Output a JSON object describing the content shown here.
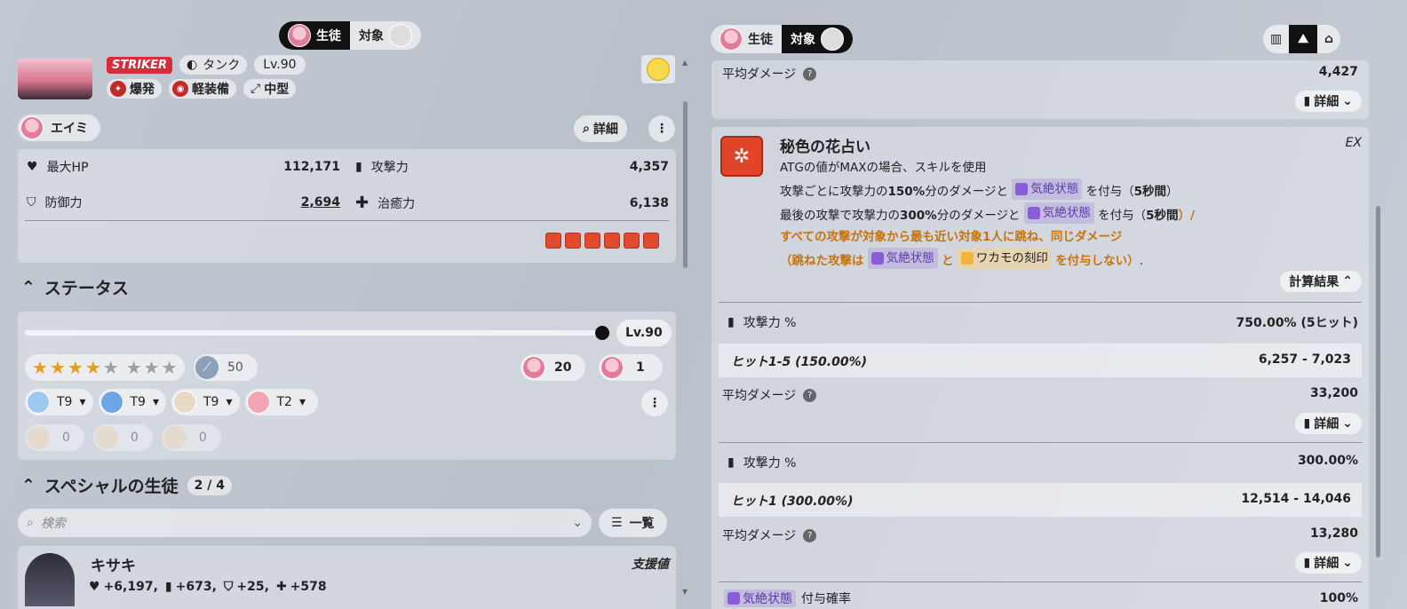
{
  "left_header": {
    "tab_student": "生徒",
    "tab_target": "対象"
  },
  "right_header": {
    "tab_student": "生徒",
    "tab_target": "対象"
  },
  "profile": {
    "class_badge": "STRIKER",
    "role": "タンク",
    "level": "Lv.90",
    "attack_type": "爆発",
    "armor_type": "軽装備",
    "position": "中型"
  },
  "student": {
    "name": "エイミ",
    "detail_label": "詳細"
  },
  "stats": [
    {
      "label": "最大HP",
      "value": "112,171",
      "icon": "heart-icon"
    },
    {
      "label": "攻撃力",
      "value": "4,357",
      "icon": "sword-icon"
    },
    {
      "label": "防御力",
      "value": "2,694",
      "icon": "shield-icon"
    },
    {
      "label": "治癒力",
      "value": "6,138",
      "icon": "cross-icon"
    }
  ],
  "status_section": {
    "title": "ステータス",
    "level": "Lv.90",
    "weapon_level": "50",
    "bond1": "20",
    "bond2": "1",
    "gear": [
      "T9",
      "T9",
      "T9",
      "T2"
    ],
    "items": [
      "0",
      "0",
      "0"
    ],
    "stars_filled": 4,
    "stars_total": 7
  },
  "special_section": {
    "title": "スペシャルの生徒",
    "count": "2 / 4",
    "search_placeholder": "検索",
    "list_label": "一覧"
  },
  "support_student": {
    "name": "キサキ",
    "tag": "支援値",
    "bonus_hp": "+6,197,",
    "bonus_atk": "+673,",
    "bonus_def": "+25,",
    "bonus_heal": "+578"
  },
  "right_top": {
    "avg_label": "平均ダメージ",
    "avg_value": "4,427",
    "detail_label": "詳細"
  },
  "skill": {
    "name": "秘色の花占い",
    "type": "EX",
    "line1": "ATGの値がMAXの場合、スキルを使用",
    "line2_a": "攻撃ごとに攻撃力の",
    "line2_b": "150%",
    "line2_c": "分のダメージと",
    "line2_tag": "気絶状態",
    "line2_d": "を付与（",
    "line2_e": "5秒間",
    "line2_f": "）",
    "line3_a": "最後の攻撃で攻撃力の",
    "line3_b": "300%",
    "line3_c": "分のダメージと",
    "line3_tag": "気絶状態",
    "line3_d": "を付与（",
    "line3_e": "5秒間",
    "line3_f": "）/",
    "line4": "すべての攻撃が対象から最も近い対象1人に跳ね、同じダメージ",
    "line5_a": "（跳ねた攻撃は",
    "line5_tag": "気絶状態",
    "line5_b": "と",
    "line5_ytag": "ワカモの刻印",
    "line5_c": "を付与しない）",
    "line5_d": ".",
    "calc_label": "計算結果"
  },
  "calc1": {
    "atk_label": "攻撃力 %",
    "atk_value": "750.00% (5ヒット)",
    "hit_label": "ヒット1-5 (150.00%)",
    "hit_value": "6,257 - 7,023",
    "avg_label": "平均ダメージ",
    "avg_value": "33,200",
    "detail_label": "詳細"
  },
  "calc2": {
    "atk_label": "攻撃力 %",
    "atk_value": "300.00%",
    "hit_label": "ヒット1 (300.00%)",
    "hit_value": "12,514 - 14,046",
    "avg_label": "平均ダメージ",
    "avg_value": "13,280",
    "detail_label": "詳細"
  },
  "calc3": {
    "tag": "気絶状態",
    "label": "付与確率",
    "value": "100%"
  }
}
